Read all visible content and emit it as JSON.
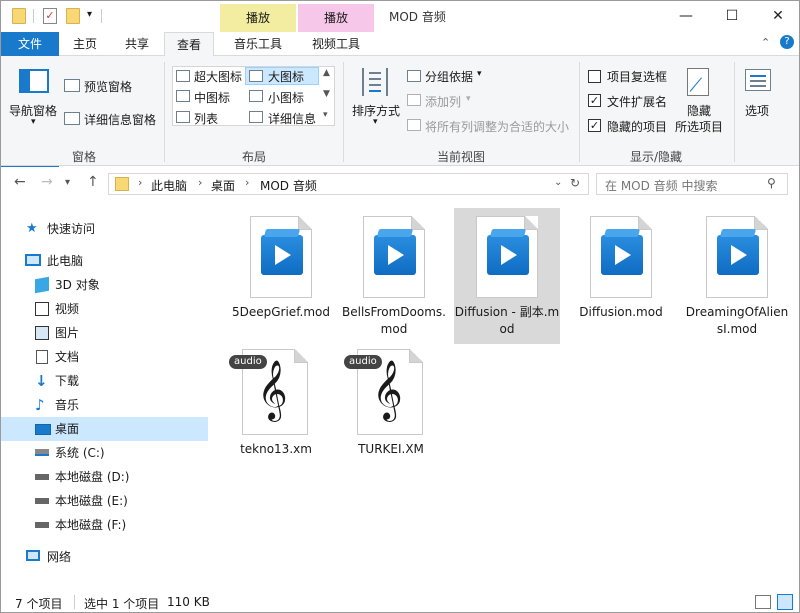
{
  "window": {
    "title": "MOD 音频",
    "minimize": "—",
    "maximize": "☐",
    "close": "✕"
  },
  "context_tabs": [
    {
      "group": "播放",
      "color": "#f2eda0"
    },
    {
      "group": "播放",
      "color": "#f6c7e8"
    }
  ],
  "tabs": [
    {
      "label": "文件"
    },
    {
      "label": "主页"
    },
    {
      "label": "共享"
    },
    {
      "label": "查看"
    },
    {
      "label": "音乐工具"
    },
    {
      "label": "视频工具"
    }
  ],
  "ribbon": {
    "pane": {
      "nav_pane": "导航窗格",
      "preview_pane": "预览窗格",
      "details_pane": "详细信息窗格",
      "group_label": "窗格"
    },
    "layout": {
      "options": [
        "超大图标",
        "大图标",
        "中图标",
        "小图标",
        "列表",
        "详细信息"
      ],
      "selected": "大图标",
      "group_label": "布局"
    },
    "current_view": {
      "sort_by": "排序方式",
      "group_by": "分组依据",
      "add_column": "添加列",
      "fit_columns": "将所有列调整为合适的大小",
      "group_label": "当前视图"
    },
    "show_hide": {
      "item_checkboxes": "项目复选框",
      "item_checkboxes_checked": false,
      "file_extensions": "文件扩展名",
      "file_extensions_checked": true,
      "hidden_items": "隐藏的项目",
      "hidden_items_checked": true,
      "hide_selected_line1": "隐藏",
      "hide_selected_line2": "所选项目",
      "group_label": "显示/隐藏"
    },
    "options": "选项"
  },
  "address": {
    "path": [
      "此电脑",
      "桌面",
      "MOD 音频"
    ],
    "search_placeholder": "在 MOD 音频 中搜索"
  },
  "sidebar": {
    "items": [
      {
        "label": "快速访问",
        "icon": "star-icon"
      },
      {
        "label": "此电脑",
        "icon": "computer-icon"
      },
      {
        "label": "3D 对象",
        "icon": "cube-icon"
      },
      {
        "label": "视频",
        "icon": "video-icon"
      },
      {
        "label": "图片",
        "icon": "picture-icon"
      },
      {
        "label": "文档",
        "icon": "document-icon"
      },
      {
        "label": "下载",
        "icon": "download-icon"
      },
      {
        "label": "音乐",
        "icon": "music-icon"
      },
      {
        "label": "桌面",
        "icon": "desktop-icon",
        "selected": true
      },
      {
        "label": "系统 (C:)",
        "icon": "drive-icon"
      },
      {
        "label": "本地磁盘 (D:)",
        "icon": "drive-icon"
      },
      {
        "label": "本地磁盘 (E:)",
        "icon": "drive-icon"
      },
      {
        "label": "本地磁盘 (F:)",
        "icon": "drive-icon"
      },
      {
        "label": "网络",
        "icon": "network-icon"
      }
    ]
  },
  "files": [
    {
      "name": "5DeepGrief.mod",
      "type": "video"
    },
    {
      "name": "BellsFromDooms.mod",
      "type": "video"
    },
    {
      "name": "Diffusion - 副本.mod",
      "type": "video",
      "selected": true
    },
    {
      "name": "Diffusion.mod",
      "type": "video"
    },
    {
      "name": "DreamingOfAliensI.mod",
      "type": "video"
    },
    {
      "name": "tekno13.xm",
      "type": "audio",
      "badge": "audio"
    },
    {
      "name": "TURKEI.XM",
      "type": "audio",
      "badge": "audio"
    }
  ],
  "status": {
    "count": "7 个项目",
    "selection": "选中 1 个项目",
    "size": "110 KB"
  }
}
